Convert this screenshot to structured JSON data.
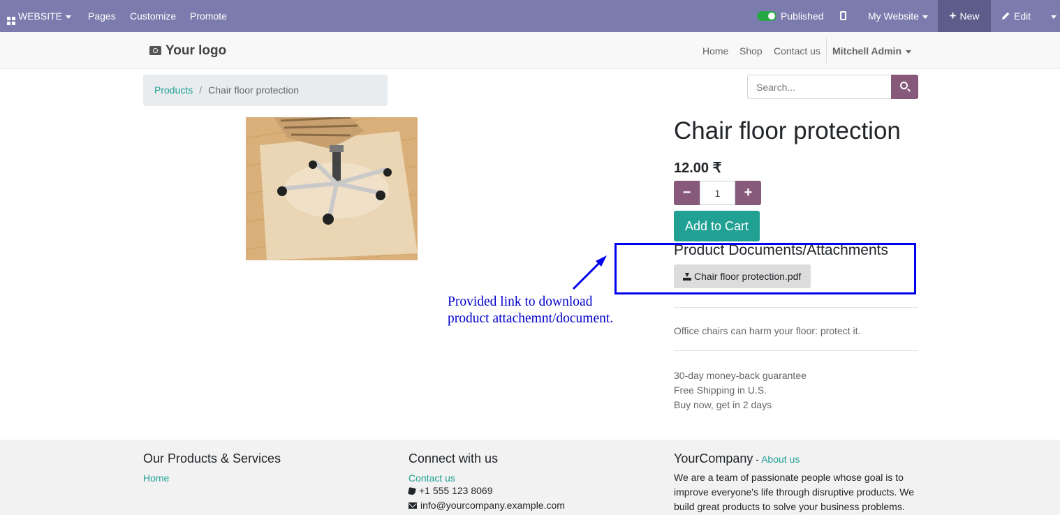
{
  "admin_bar": {
    "website_menu": "WEBSITE",
    "pages": "Pages",
    "customize": "Customize",
    "promote": "Promote",
    "published": "Published",
    "my_website": "My Website",
    "new": "New",
    "edit": "Edit"
  },
  "header": {
    "logo": "Your logo",
    "nav": [
      "Home",
      "Shop",
      "Contact us"
    ],
    "user": "Mitchell Admin"
  },
  "breadcrumb": {
    "parent": "Products",
    "separator": "/",
    "current": "Chair floor protection"
  },
  "search": {
    "placeholder": "Search..."
  },
  "product": {
    "name": "Chair floor protection",
    "price": "12.00 ₹",
    "quantity": "1",
    "add_to_cart": "Add to Cart",
    "documents_title": "Product Documents/Attachments",
    "document_file": "Chair floor protection.pdf",
    "description": "Office chairs can harm your floor: protect it.",
    "terms": [
      "30-day money-back guarantee",
      "Free Shipping in U.S.",
      "Buy now, get in 2 days"
    ]
  },
  "annotation": {
    "line1": "Provided link to download",
    "line2": "product attachemnt/document."
  },
  "footer": {
    "col1_title": "Our Products & Services",
    "col1_link": "Home",
    "col2_title": "Connect with us",
    "col2_link": "Contact us",
    "phone": "+1 555 123 8069",
    "email": "info@yourcompany.example.com",
    "col3_title": "YourCompany",
    "col3_dash": " - ",
    "col3_link": "About us",
    "about_text": [
      "We are a team of passionate people whose goal is to",
      "improve everyone's life through disruptive products. We",
      "build great products to solve your business problems."
    ]
  },
  "colors": {
    "admin_bar": "#7c7bad",
    "primary": "#875a7b",
    "accent": "#21a094",
    "annotation": "#0000ee"
  },
  "icons": [
    "apps-grid-icon",
    "toggle-switch-icon",
    "mobile-preview-icon",
    "plus-icon",
    "pencil-icon",
    "camera-icon",
    "search-icon",
    "minus-icon",
    "download-icon",
    "phone-icon",
    "envelope-icon"
  ]
}
